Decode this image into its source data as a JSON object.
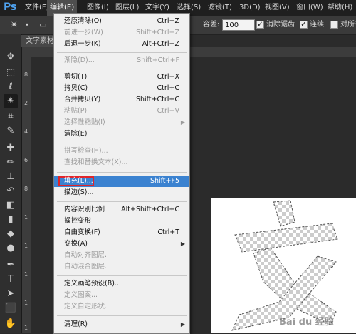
{
  "app": {
    "logo": "Ps"
  },
  "menubar": {
    "items": [
      {
        "label": "文件(F)"
      },
      {
        "label": "编辑(E)"
      },
      {
        "label": "图像(I)"
      },
      {
        "label": "图层(L)"
      },
      {
        "label": "文字(Y)"
      },
      {
        "label": "选择(S)"
      },
      {
        "label": "滤镜(T)"
      },
      {
        "label": "3D(D)"
      },
      {
        "label": "视图(V)"
      },
      {
        "label": "窗口(W)"
      },
      {
        "label": "帮助(H)"
      }
    ]
  },
  "options": {
    "tolerance_label": "容差:",
    "tolerance_value": "100",
    "antialias_label": "消除锯齿",
    "contiguous_label": "连续",
    "sample_all_label": "对所有"
  },
  "document": {
    "tab_label": "文字素材"
  },
  "rulers": {
    "v_marks": [
      "8",
      "2",
      "4",
      "6",
      "8",
      "1",
      "1",
      "1",
      "1",
      "1"
    ]
  },
  "edit_menu": {
    "items": [
      {
        "label": "还原清除(O)",
        "shortcut": "Ctrl+Z",
        "enabled": true
      },
      {
        "label": "前进一步(W)",
        "shortcut": "Shift+Ctrl+Z",
        "enabled": false
      },
      {
        "label": "后退一步(K)",
        "shortcut": "Alt+Ctrl+Z",
        "enabled": true
      },
      {
        "label": "渐隐(D)...",
        "shortcut": "Shift+Ctrl+F",
        "enabled": false
      },
      {
        "label": "剪切(T)",
        "shortcut": "Ctrl+X",
        "enabled": true
      },
      {
        "label": "拷贝(C)",
        "shortcut": "Ctrl+C",
        "enabled": true
      },
      {
        "label": "合并拷贝(Y)",
        "shortcut": "Shift+Ctrl+C",
        "enabled": true
      },
      {
        "label": "粘贴(P)",
        "shortcut": "Ctrl+V",
        "enabled": false
      },
      {
        "label": "选择性粘贴(I)",
        "shortcut": "",
        "enabled": false
      },
      {
        "label": "清除(E)",
        "shortcut": "",
        "enabled": true
      },
      {
        "label": "拼写检查(H)...",
        "shortcut": "",
        "enabled": false
      },
      {
        "label": "查找和替换文本(X)...",
        "shortcut": "",
        "enabled": false
      },
      {
        "label": "填充(L)...",
        "shortcut": "Shift+F5",
        "enabled": true,
        "highlighted": true
      },
      {
        "label": "描边(S)...",
        "shortcut": "",
        "enabled": true
      },
      {
        "label": "内容识别比例",
        "shortcut": "Alt+Shift+Ctrl+C",
        "enabled": true
      },
      {
        "label": "操控变形",
        "shortcut": "",
        "enabled": true
      },
      {
        "label": "自由变换(F)",
        "shortcut": "Ctrl+T",
        "enabled": true
      },
      {
        "label": "变换(A)",
        "shortcut": "",
        "enabled": true
      },
      {
        "label": "自动对齐图层...",
        "shortcut": "",
        "enabled": false
      },
      {
        "label": "自动混合图层...",
        "shortcut": "",
        "enabled": false
      },
      {
        "label": "定义画笔预设(B)...",
        "shortcut": "",
        "enabled": true
      },
      {
        "label": "定义图案...",
        "shortcut": "",
        "enabled": false
      },
      {
        "label": "定义自定形状...",
        "shortcut": "",
        "enabled": false
      },
      {
        "label": "清理(R)",
        "shortcut": "",
        "enabled": true
      }
    ]
  },
  "canvas": {
    "glyph": "文"
  },
  "watermark": {
    "text": "Bai du 经验"
  },
  "colors": {
    "highlight": "#3b82d0",
    "callout_border": "#e0242a",
    "ps_blue": "#4fa3f0"
  }
}
